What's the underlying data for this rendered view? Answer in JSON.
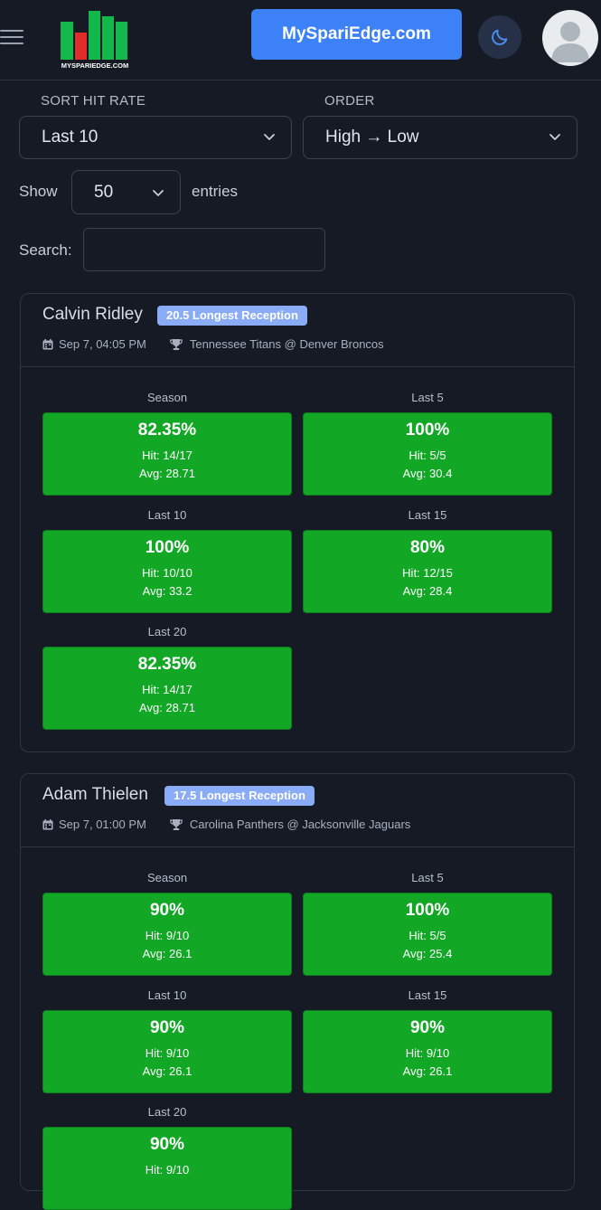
{
  "header": {
    "brand_button": "MySpariEdge.com",
    "logo_text": "MYSPARIEDGE.COM",
    "icons": {
      "menu": "hamburger-icon",
      "theme": "moon-icon",
      "avatar": "user-avatar-icon"
    },
    "accent_color": "#3c82f6"
  },
  "controls": {
    "sort_label": "SORT HIT RATE",
    "sort_value": "Last 10",
    "order_label": "ORDER",
    "order_value": "High → Low",
    "show_label": "Show",
    "entries_value": "50",
    "entries_label": "entries",
    "search_label": "Search:",
    "search_value": ""
  },
  "cards": [
    {
      "player": "Calvin Ridley",
      "prop": "20.5 Longest Reception",
      "date": "Sep 7, 04:05 PM",
      "matchup": "Tennessee Titans @ Denver Broncos",
      "stats": [
        {
          "label": "Season",
          "pct": "82.35%",
          "hit": "Hit: 14/17",
          "avg": "Avg: 28.71"
        },
        {
          "label": "Last 5",
          "pct": "100%",
          "hit": "Hit: 5/5",
          "avg": "Avg: 30.4"
        },
        {
          "label": "Last 10",
          "pct": "100%",
          "hit": "Hit: 10/10",
          "avg": "Avg: 33.2"
        },
        {
          "label": "Last 15",
          "pct": "80%",
          "hit": "Hit: 12/15",
          "avg": "Avg: 28.4"
        },
        {
          "label": "Last 20",
          "pct": "82.35%",
          "hit": "Hit: 14/17",
          "avg": "Avg: 28.71"
        }
      ]
    },
    {
      "player": "Adam Thielen",
      "prop": "17.5 Longest Reception",
      "date": "Sep 7, 01:00 PM",
      "matchup": "Carolina Panthers @ Jacksonville Jaguars",
      "stats": [
        {
          "label": "Season",
          "pct": "90%",
          "hit": "Hit: 9/10",
          "avg": "Avg: 26.1"
        },
        {
          "label": "Last 5",
          "pct": "100%",
          "hit": "Hit: 5/5",
          "avg": "Avg: 25.4"
        },
        {
          "label": "Last 10",
          "pct": "90%",
          "hit": "Hit: 9/10",
          "avg": "Avg: 26.1"
        },
        {
          "label": "Last 15",
          "pct": "90%",
          "hit": "Hit: 9/10",
          "avg": "Avg: 26.1"
        },
        {
          "label": "Last 20",
          "pct": "90%",
          "hit": "Hit: 9/10",
          "avg": ""
        }
      ]
    }
  ],
  "colors": {
    "hit_green": "#12a825",
    "badge_blue": "#8aabf5",
    "background": "#151a25"
  }
}
